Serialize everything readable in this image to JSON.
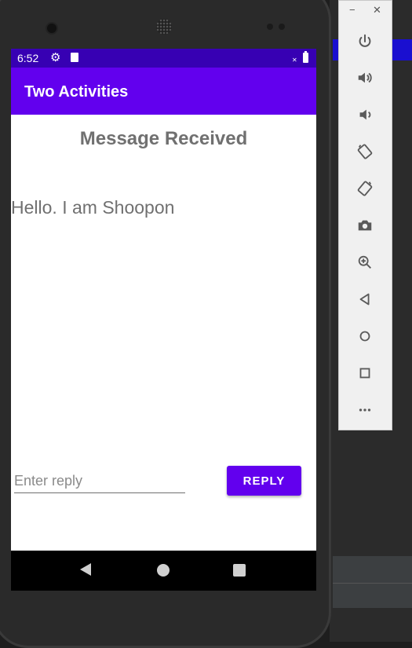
{
  "status_bar": {
    "time": "6:52",
    "icons": [
      "gear-icon",
      "sd-card-icon",
      "no-signal-icon",
      "battery-icon"
    ]
  },
  "app_bar": {
    "title": "Two Activities"
  },
  "content": {
    "header": "Message Received",
    "message": "Hello. I am Shoopon"
  },
  "reply": {
    "placeholder": "Enter reply",
    "value": "",
    "button_label": "REPLY"
  },
  "nav_bar": {
    "buttons": [
      "back-icon",
      "home-icon",
      "recents-icon"
    ]
  },
  "emulator_toolbar": {
    "window_controls": [
      "minimize-icon",
      "close-icon"
    ],
    "buttons": [
      "power-icon",
      "volume-up-icon",
      "volume-down-icon",
      "rotate-left-icon",
      "rotate-right-icon",
      "camera-icon",
      "zoom-icon",
      "back-icon",
      "home-icon",
      "overview-icon",
      "more-icon"
    ]
  },
  "colors": {
    "primary": "#6200ee",
    "primary_dark": "#3700b3",
    "text_gray": "#707070"
  }
}
